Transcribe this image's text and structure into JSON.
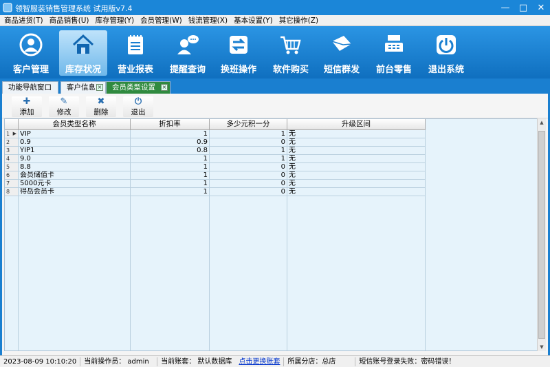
{
  "window": {
    "title": "领智服装销售管理系统 试用版v7.4",
    "min": "—",
    "max": "□",
    "close": "✕"
  },
  "menu": [
    "商品进货(T)",
    "商品销售(U)",
    "库存管理(Y)",
    "会员管理(W)",
    "钱流管理(X)",
    "基本设置(Y)",
    "其它操作(Z)"
  ],
  "toolbar": [
    {
      "label": "客户管理",
      "icon": "user-circle-icon"
    },
    {
      "label": "库存状况",
      "icon": "house-icon",
      "active": true
    },
    {
      "label": "营业报表",
      "icon": "notebook-icon"
    },
    {
      "label": "提醒查询",
      "icon": "chat-user-icon"
    },
    {
      "label": "换班操作",
      "icon": "swap-arrows-icon"
    },
    {
      "label": "软件购买",
      "icon": "cart-icon"
    },
    {
      "label": "短信群发",
      "icon": "envelope-icon"
    },
    {
      "label": "前台零售",
      "icon": "cash-register-icon"
    },
    {
      "label": "退出系统",
      "icon": "power-icon"
    }
  ],
  "tabs": [
    {
      "label": "功能导航窗口"
    },
    {
      "label": "客户信息"
    },
    {
      "label": "会员类型设置",
      "active": true
    }
  ],
  "actions": [
    {
      "label": "添加",
      "icon": "plus-icon"
    },
    {
      "label": "修改",
      "icon": "pencil-icon"
    },
    {
      "label": "删除",
      "icon": "delete-x-icon"
    },
    {
      "label": "退出",
      "icon": "power-icon"
    }
  ],
  "grid": {
    "columns": [
      "会员类型名称",
      "折扣率",
      "多少元积一分",
      "升级区间"
    ],
    "rows": [
      {
        "n": "1",
        "name": "VIP",
        "discount": "1",
        "points": "1",
        "upgrade": "无",
        "current": true
      },
      {
        "n": "2",
        "name": "0.9",
        "discount": "0.9",
        "points": "0",
        "upgrade": "无"
      },
      {
        "n": "3",
        "name": "YIP1",
        "discount": "0.8",
        "points": "1",
        "upgrade": "无"
      },
      {
        "n": "4",
        "name": "9.0",
        "discount": "1",
        "points": "1",
        "upgrade": "无"
      },
      {
        "n": "5",
        "name": "8.8",
        "discount": "1",
        "points": "0",
        "upgrade": "无"
      },
      {
        "n": "6",
        "name": "会员储值卡",
        "discount": "1",
        "points": "0",
        "upgrade": "无"
      },
      {
        "n": "7",
        "name": "5000元卡",
        "discount": "1",
        "points": "0",
        "upgrade": "无"
      },
      {
        "n": "8",
        "name": "得岳会员卡",
        "discount": "1",
        "points": "0",
        "upgrade": "无"
      }
    ]
  },
  "status": {
    "datetime": "2023-08-09 10:10:20",
    "operator": "当前操作员： admin",
    "account": "当前账套： 默认数据库",
    "switch_link": "点击更换账套",
    "branch": "所属分店：总店",
    "sms": "短信账号登录失败：密码错误！"
  },
  "colors": {
    "toolbar": "#1a7fd0",
    "active_tab": "#2f8a3f",
    "grid_bg": "#e6f3fb"
  }
}
